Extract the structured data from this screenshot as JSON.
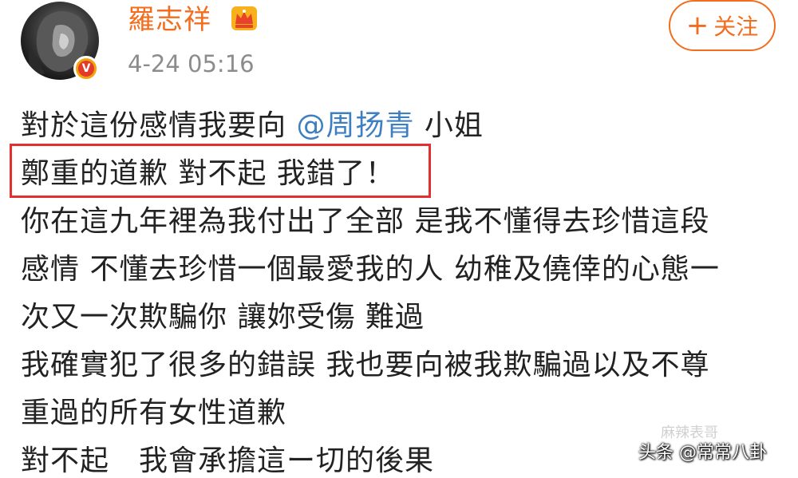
{
  "post": {
    "user_name": "羅志祥",
    "timestamp": "4-24 05:16",
    "verified_mark": "V",
    "follow_label": "关注",
    "follow_icon": "+",
    "line1_prefix": "對於這份感情我要向 ",
    "line1_mention": "@周扬青",
    "line1_suffix": " 小姐",
    "line2": "鄭重的道歉 對不起 我錯了！",
    "line3": "你在這九年裡為我付出了全部 是我不懂得去珍惜這段",
    "line4": "感情 不懂去珍惜一個最愛我的人 幼稚及僥倖的心態一",
    "line5": "次又一次欺騙你 讓妳受傷 難過",
    "line6": "我確實犯了很多的錯誤 我也要向被我欺騙過以及不尊",
    "line7": "重過的所有女性道歉",
    "line8": "對不起　我會承擔這ー切的後果"
  },
  "watermark": {
    "main": "头条 @常常八卦",
    "faint": "麻辣表哥"
  },
  "colors": {
    "name_orange": "#f26d1e",
    "mention_blue": "#3e7fc1",
    "highlight_red": "#e23030",
    "badge_gold": "#f2a40d"
  },
  "icons": {
    "avatar": "lion-avatar",
    "verified": "verified-badge-icon",
    "crown": "crown-icon",
    "follow": "plus-icon"
  }
}
